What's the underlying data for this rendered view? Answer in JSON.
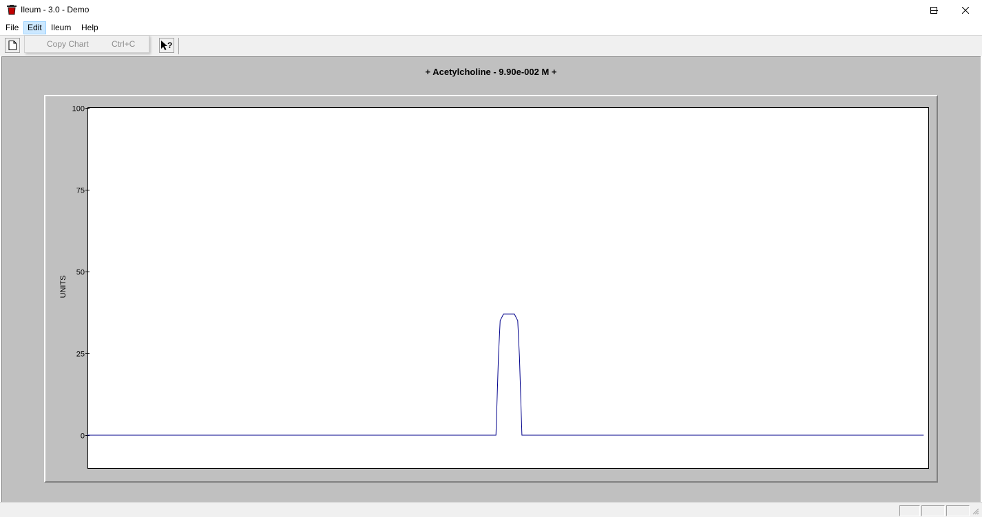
{
  "window": {
    "title": "Ileum - 3.0 - Demo",
    "minimize_icon": "minimize-icon",
    "maximize_icon": "maximize-icon",
    "close_icon": "close-icon"
  },
  "menu": {
    "items": [
      "File",
      "Edit",
      "Ileum",
      "Help"
    ],
    "active": "Edit"
  },
  "edit_menu": {
    "items": [
      {
        "label": "Copy Chart",
        "shortcut": "Ctrl+C",
        "enabled": false
      }
    ]
  },
  "toolbar": {
    "buttons": [
      "new-document-icon",
      "context-help-icon"
    ]
  },
  "chart": {
    "title": "+ Acetylcholine - 9.90e-002 M +",
    "line_color": "#00008b"
  },
  "chart_data": {
    "type": "line",
    "title": "+ Acetylcholine - 9.90e-002 M +",
    "xlabel": "",
    "ylabel": "UNITS",
    "ylim": [
      0,
      100
    ],
    "yticks": [
      "0",
      "25",
      "50",
      "75",
      "100"
    ],
    "xlim": [
      0,
      1000
    ],
    "grid": false,
    "series": [
      {
        "x": [
          0,
          487,
          490,
          492,
          496,
          509,
          513,
          515,
          518,
          997
        ],
        "y": [
          0,
          0,
          24,
          35,
          37,
          37,
          35,
          24,
          0,
          0
        ]
      }
    ]
  }
}
